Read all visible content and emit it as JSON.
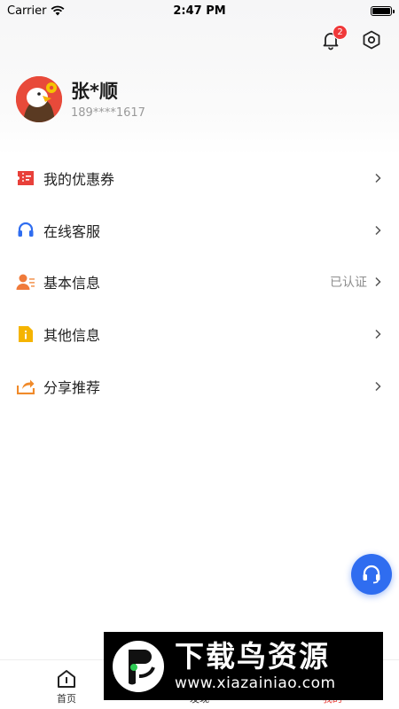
{
  "status_bar": {
    "carrier": "Carrier",
    "time": "2:47 PM"
  },
  "header": {
    "notification_count": "2"
  },
  "profile": {
    "name": "张*顺",
    "phone": "189****1617"
  },
  "menu": [
    {
      "label": "我的优惠券",
      "status": "",
      "icon": "coupon-icon",
      "color": "#e8403a"
    },
    {
      "label": "在线客服",
      "status": "",
      "icon": "headset-icon",
      "color": "#2f6df0"
    },
    {
      "label": "基本信息",
      "status": "已认证",
      "icon": "user-card-icon",
      "color": "#f07a3a"
    },
    {
      "label": "其他信息",
      "status": "",
      "icon": "info-doc-icon",
      "color": "#f5b400"
    },
    {
      "label": "分享推荐",
      "status": "",
      "icon": "share-icon",
      "color": "#f08a2a"
    }
  ],
  "tabs": [
    {
      "label": "首页",
      "active": false
    },
    {
      "label": "发现",
      "active": false
    },
    {
      "label": "我的",
      "active": true
    }
  ],
  "watermark": {
    "title": "下载鸟资源",
    "url": "www.xiazainiao.com"
  },
  "colors": {
    "accent": "#e8403a",
    "primary_blue": "#2f6df0",
    "text": "#222222",
    "muted": "#9a9a9a"
  }
}
